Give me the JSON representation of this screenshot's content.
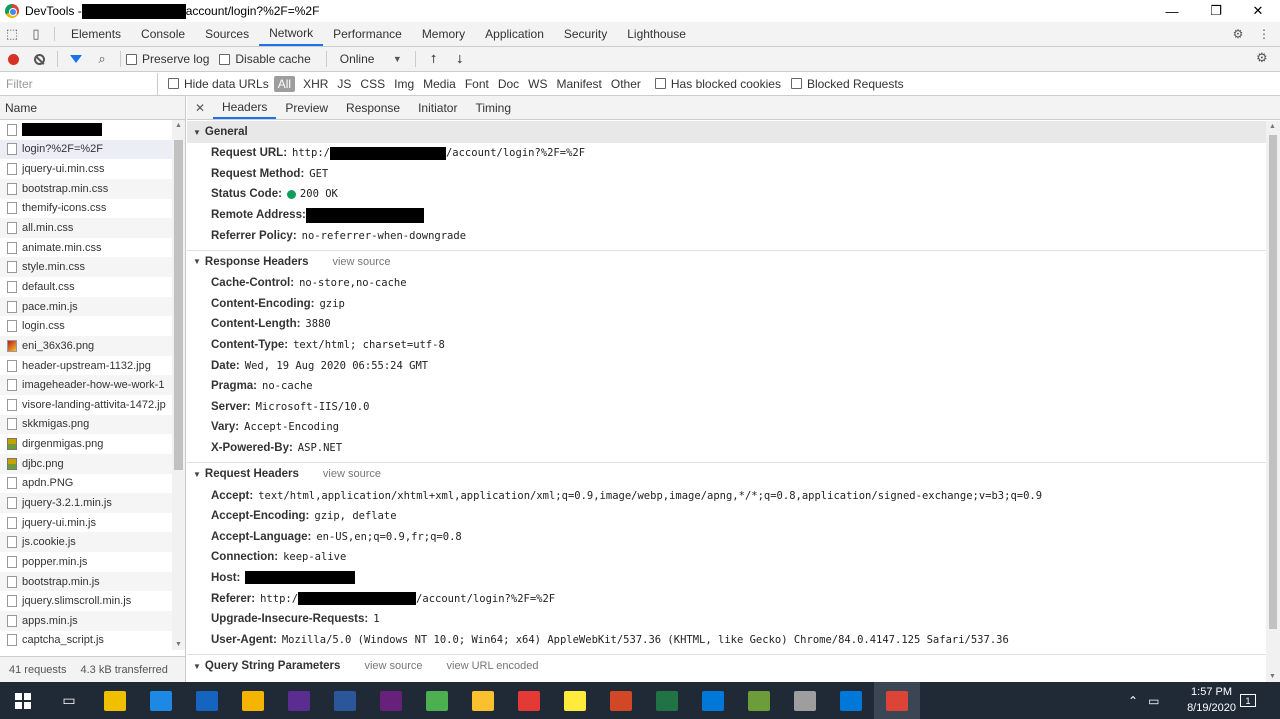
{
  "window": {
    "title_prefix": "DevTools - ",
    "title_suffix": "account/login?%2F=%2F",
    "minimize": "—",
    "maximize": "❐",
    "close": "✕"
  },
  "main_tabs": [
    "Elements",
    "Console",
    "Sources",
    "Network",
    "Performance",
    "Memory",
    "Application",
    "Security",
    "Lighthouse"
  ],
  "active_main_tab": "Network",
  "toolbar": {
    "preserve_log": "Preserve log",
    "disable_cache": "Disable cache",
    "throttle": "Online"
  },
  "filter": {
    "placeholder": "Filter",
    "hide_data_urls": "Hide data URLs",
    "all": "All",
    "types": [
      "XHR",
      "JS",
      "CSS",
      "Img",
      "Media",
      "Font",
      "Doc",
      "WS",
      "Manifest",
      "Other"
    ],
    "has_blocked_cookies": "Has blocked cookies",
    "blocked_requests": "Blocked Requests"
  },
  "requests": {
    "header": "Name",
    "items": [
      {
        "name": "",
        "redacted": true
      },
      {
        "name": "login?%2F=%2F",
        "selected": true
      },
      {
        "name": "jquery-ui.min.css"
      },
      {
        "name": "bootstrap.min.css"
      },
      {
        "name": "themify-icons.css"
      },
      {
        "name": "all.min.css"
      },
      {
        "name": "animate.min.css"
      },
      {
        "name": "style.min.css"
      },
      {
        "name": "default.css"
      },
      {
        "name": "pace.min.js"
      },
      {
        "name": "login.css"
      },
      {
        "name": "eni_36x36.png",
        "icon": "img2"
      },
      {
        "name": "header-upstream-1132.jpg"
      },
      {
        "name": "imageheader-how-we-work-1"
      },
      {
        "name": "visore-landing-attivita-1472.jp"
      },
      {
        "name": "skkmigas.png"
      },
      {
        "name": "dirgenmigas.png",
        "icon": "img"
      },
      {
        "name": "djbc.png",
        "icon": "img"
      },
      {
        "name": "apdn.PNG"
      },
      {
        "name": "jquery-3.2.1.min.js"
      },
      {
        "name": "jquery-ui.min.js"
      },
      {
        "name": "js.cookie.js"
      },
      {
        "name": "popper.min.js"
      },
      {
        "name": "bootstrap.min.js"
      },
      {
        "name": "jquery.slimscroll.min.js"
      },
      {
        "name": "apps.min.js"
      },
      {
        "name": "captcha_script.js"
      }
    ],
    "status_requests": "41 requests",
    "status_transferred": "4.3 kB transferred"
  },
  "detail_tabs": [
    "Headers",
    "Preview",
    "Response",
    "Initiator",
    "Timing"
  ],
  "active_detail_tab": "Headers",
  "general": {
    "title": "General",
    "request_url_label": "Request URL:",
    "request_url_prefix": "http:/",
    "request_url_suffix": "/account/login?%2F=%2F",
    "request_method_label": "Request Method:",
    "request_method": "GET",
    "status_code_label": "Status Code:",
    "status_code": "200 OK",
    "remote_address_label": "Remote Address:",
    "referrer_policy_label": "Referrer Policy:",
    "referrer_policy": "no-referrer-when-downgrade"
  },
  "response_headers": {
    "title": "Response Headers",
    "view_source": "view source",
    "items": [
      {
        "k": "Cache-Control:",
        "v": "no-store,no-cache"
      },
      {
        "k": "Content-Encoding:",
        "v": "gzip"
      },
      {
        "k": "Content-Length:",
        "v": "3880"
      },
      {
        "k": "Content-Type:",
        "v": "text/html; charset=utf-8"
      },
      {
        "k": "Date:",
        "v": "Wed, 19 Aug 2020 06:55:24 GMT"
      },
      {
        "k": "Pragma:",
        "v": "no-cache"
      },
      {
        "k": "Server:",
        "v": "Microsoft-IIS/10.0"
      },
      {
        "k": "Vary:",
        "v": "Accept-Encoding"
      },
      {
        "k": "X-Powered-By:",
        "v": "ASP.NET"
      }
    ]
  },
  "request_headers": {
    "title": "Request Headers",
    "view_source": "view source",
    "accept_label": "Accept:",
    "accept": "text/html,application/xhtml+xml,application/xml;q=0.9,image/webp,image/apng,*/*;q=0.8,application/signed-exchange;v=b3;q=0.9",
    "accept_encoding_label": "Accept-Encoding:",
    "accept_encoding": "gzip, deflate",
    "accept_language_label": "Accept-Language:",
    "accept_language": "en-US,en;q=0.9,fr;q=0.8",
    "connection_label": "Connection:",
    "connection": "keep-alive",
    "host_label": "Host:",
    "referer_label": "Referer:",
    "referer_prefix": "http:/",
    "referer_suffix": "/account/login?%2F=%2F",
    "upgrade_label": "Upgrade-Insecure-Requests:",
    "upgrade": "1",
    "user_agent_label": "User-Agent:",
    "user_agent": "Mozilla/5.0 (Windows NT 10.0; Win64; x64) AppleWebKit/537.36 (KHTML, like Gecko) Chrome/84.0.4147.125 Safari/537.36"
  },
  "query_string": {
    "title": "Query String Parameters",
    "view_source": "view source",
    "view_url_encoded": "view URL encoded"
  },
  "taskbar": {
    "time": "1:57 PM",
    "date": "8/19/2020",
    "notification_count": "1",
    "app_colors": [
      "#f0c000",
      "#1e88e5",
      "#1565c0",
      "#f4b400",
      "#5c2d91",
      "#2b579a",
      "#68217a",
      "#4caf50",
      "#fbc02d",
      "#e53935",
      "#ffeb3b",
      "#d24726",
      "#217346",
      "#0078d7",
      "#6d9c3a",
      "#9e9e9e",
      "#0078d7",
      "#db4437"
    ]
  }
}
